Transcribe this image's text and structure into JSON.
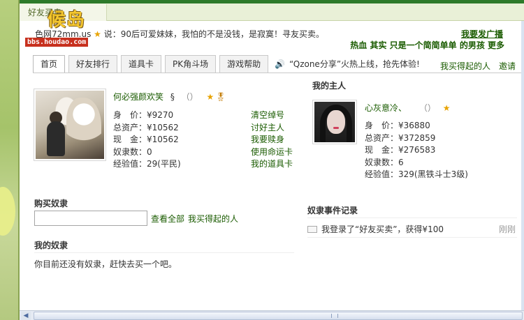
{
  "window": {
    "title": "好友买卖"
  },
  "watermark": {
    "logo_text": "候岛",
    "url": "bbs.houdao.com"
  },
  "status": {
    "prefix": "色网72mm.us",
    "message": "说：90后可爱妹妹，我怕的不是没钱，是寂寞！寻友买卖。",
    "share_link": "我要发广播",
    "slogan": "热血   其实  只是一个简简单单 的男孩   更多"
  },
  "tabs": [
    {
      "label": "首页",
      "active": true
    },
    {
      "label": "好友排行",
      "active": false
    },
    {
      "label": "道具卡",
      "active": false
    },
    {
      "label": "PK角斗场",
      "active": false
    },
    {
      "label": "游戏帮助",
      "active": false
    }
  ],
  "notice": "“Qzone分享”火热上线，抢先体验!",
  "header_links": {
    "bought": "我买得起的人",
    "invite": "邀请"
  },
  "me": {
    "name": "何必强颜欢笑",
    "symbol": "§",
    "paren": "（）",
    "stats": [
      "身　价：¥9270",
      "总资产：¥10562",
      "现　金：¥10562",
      "奴隶数：0",
      "经验值：29(平民)"
    ],
    "actions": [
      "清空绰号",
      "讨好主人",
      "我要赎身",
      "使用命运卡",
      "我的道具卡"
    ]
  },
  "owner": {
    "title": "我的主人",
    "name": "心灰意冷、",
    "paren": "（）",
    "stats": [
      "身　价：¥36880",
      "总资产：¥372859",
      "现　金：¥276583",
      "奴隶数：6",
      "经验值：329(黑铁斗士3级)"
    ]
  },
  "buy": {
    "title": "购买奴隶",
    "search_value": "",
    "view_all": "查看全部",
    "affordable": "我买得起的人"
  },
  "my_slaves": {
    "title": "我的奴隶",
    "empty_text": "你目前还没有奴隶，赶快去买一个吧。"
  },
  "events": {
    "title": "奴隶事件记录",
    "items": [
      {
        "text": "我登录了“好友买卖”，获得¥100",
        "time": "刚刚"
      }
    ]
  },
  "icons": [
    "star-icon",
    "badge-icon",
    "speaker-icon",
    "mail-icon",
    "scroll-left-icon",
    "scroll-thumb-grip-icon"
  ],
  "colors": {
    "link_green": "#1a5b00",
    "top_bar_green": "#2d7a2a",
    "star_gold": "#e8a300"
  }
}
